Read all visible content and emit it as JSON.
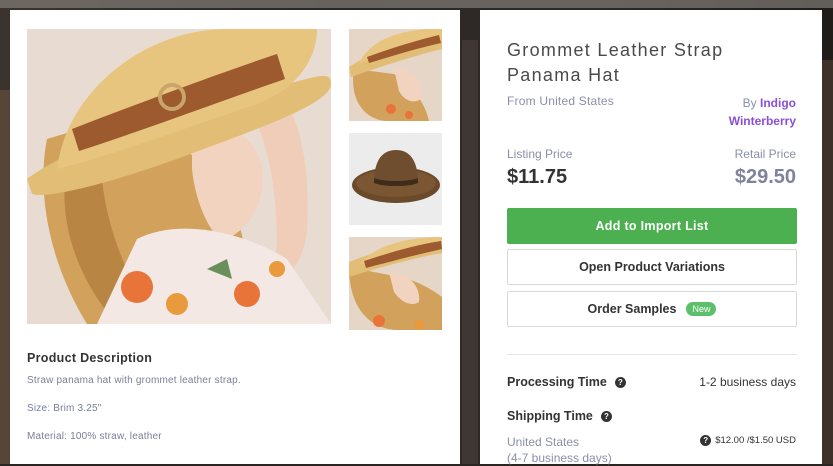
{
  "product": {
    "title": "Grommet Leather Strap Panama Hat",
    "origin": "From United States",
    "by_prefix": "By",
    "vendor": "Indigo Winterberry"
  },
  "pricing": {
    "listing_label": "Listing Price",
    "listing_price": "$11.75",
    "retail_label": "Retail Price",
    "retail_price": "$29.50"
  },
  "actions": {
    "import_label": "Add to Import List",
    "variations_label": "Open Product Variations",
    "samples_label": "Order Samples",
    "new_badge": "New"
  },
  "description": {
    "title": "Product Description",
    "lines": [
      "Straw panama hat with grommet leather strap.",
      "Size: Brim 3.25\"",
      "Material: 100% straw, leather"
    ]
  },
  "shipping": {
    "processing_label": "Processing Time",
    "processing_value": "1-2 business days",
    "shipping_label": "Shipping Time",
    "destination": "United States",
    "destination_time": "(4-7 business days)",
    "cost": "$12.00 /$1.50 USD"
  },
  "icons": {
    "help": "question-circle-icon"
  },
  "colors": {
    "import_button": "#4caf50",
    "vendor_link": "#8a4fd6",
    "new_badge": "#5cbf6a"
  }
}
